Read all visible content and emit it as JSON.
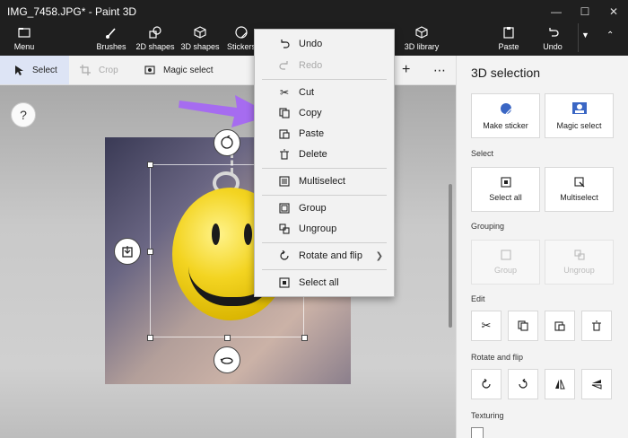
{
  "window": {
    "title": "IMG_7458.JPG* - Paint 3D"
  },
  "ribbon": {
    "menu": "Menu",
    "brushes": "Brushes",
    "shapes2d": "2D shapes",
    "shapes3d": "3D shapes",
    "stickers": "Stickers",
    "library3d": "3D library",
    "paste": "Paste",
    "undo": "Undo"
  },
  "tools": {
    "select": "Select",
    "crop": "Crop",
    "magic_select": "Magic select"
  },
  "help": "?",
  "panel": {
    "title": "3D selection",
    "make_sticker": "Make sticker",
    "magic_select": "Magic select",
    "select_header": "Select",
    "select_all": "Select all",
    "multiselect": "Multiselect",
    "grouping_header": "Grouping",
    "group": "Group",
    "ungroup": "Ungroup",
    "edit_header": "Edit",
    "rotate_header": "Rotate and flip",
    "texturing_header": "Texturing"
  },
  "context_menu": {
    "undo": "Undo",
    "redo": "Redo",
    "cut": "Cut",
    "copy": "Copy",
    "paste": "Paste",
    "delete": "Delete",
    "multiselect": "Multiselect",
    "group": "Group",
    "ungroup": "Ungroup",
    "rotate_and_flip": "Rotate and flip",
    "select_all": "Select all"
  },
  "colors": {
    "accent": "#a66cf0",
    "tool_active": "#dde4f5",
    "titlebar": "#1f1f1f"
  }
}
